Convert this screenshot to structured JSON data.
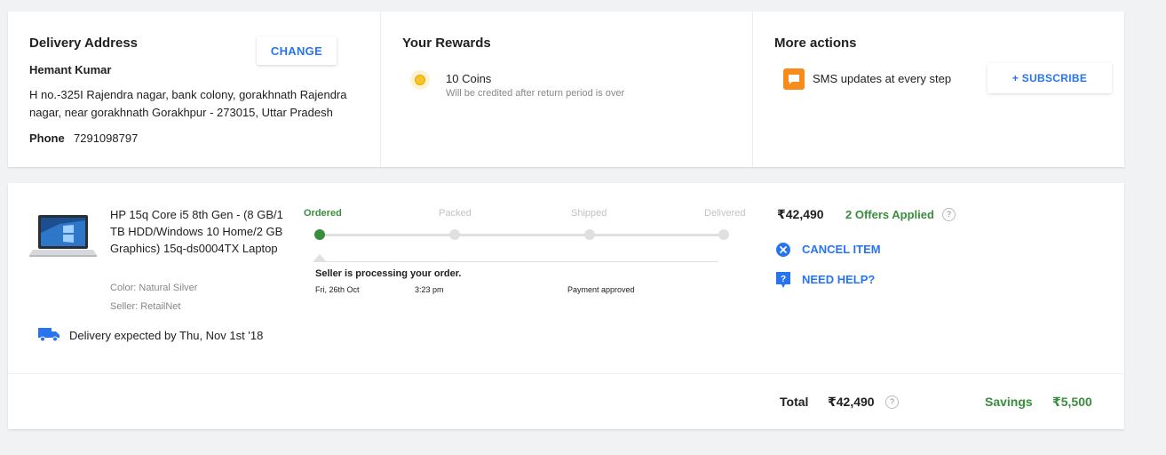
{
  "delivery": {
    "title": "Delivery Address",
    "change_label": "CHANGE",
    "name": "Hemant Kumar",
    "address": "H no.-325I Rajendra nagar, bank colony, gorakhnath Rajendra nagar, near gorakhnath Gorakhpur - 273015, Uttar Pradesh",
    "phone_label": "Phone",
    "phone": "7291098797"
  },
  "rewards": {
    "title": "Your Rewards",
    "coins": "10 Coins",
    "coins_note": "Will be credited after return period is over",
    "icon": "coin-icon"
  },
  "actions": {
    "title": "More actions",
    "sms_text": "SMS updates at every step",
    "subscribe_label": "+  SUBSCRIBE",
    "icon": "sms-icon"
  },
  "order": {
    "product_title": "HP 15q Core i5 8th Gen - (8 GB/1 TB HDD/Windows 10 Home/2 GB Graphics) 15q-ds0004TX Laptop",
    "color": "Color: Natural Silver",
    "seller": "Seller: RetailNet",
    "delivery_expected": "Delivery expected by Thu, Nov 1st '18",
    "tracking": {
      "steps": [
        "Ordered",
        "Packed",
        "Shipped",
        "Delivered"
      ],
      "current_step": 0,
      "message": "Seller is processing your order.",
      "date": "Fri, 26th Oct",
      "time": "3:23 pm",
      "status": "Payment approved"
    },
    "price": "₹42,490",
    "offers": "2 Offers Applied",
    "cancel_label": "CANCEL ITEM",
    "help_label": "NEED HELP?",
    "qmark": "?"
  },
  "summary": {
    "total_label": "Total",
    "total_value": "₹42,490",
    "savings_label": "Savings",
    "savings_value": "₹5,500"
  },
  "colors": {
    "accent_blue": "#2874f0",
    "success_green": "#388e3c",
    "sms_orange": "#f88c1a",
    "coin_yellow": "#f7c325",
    "page_bg": "#f1f2f4"
  }
}
